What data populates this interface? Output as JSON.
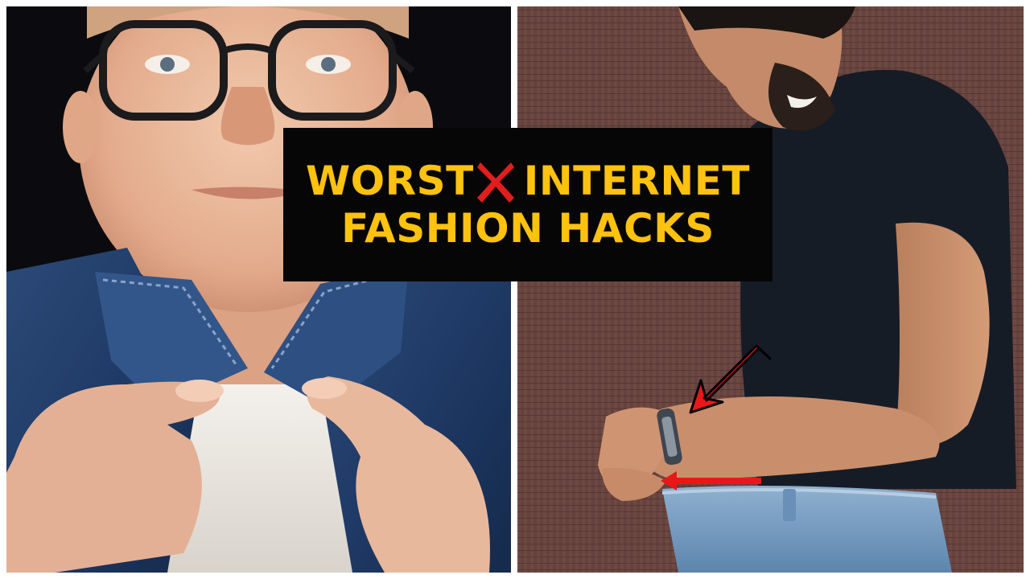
{
  "thumbnail": {
    "title_line1_part1": "WORST",
    "title_line1_part2": "INTERNET",
    "title_line2": "FASHION HACKS",
    "colors": {
      "title_text": "#ffc20e",
      "title_background": "#060606",
      "x_mark": "#e01e1e",
      "arrows": "#e81818"
    },
    "icons": {
      "x_mark": "cross-mark-icon",
      "arrow_diagonal": "arrow-down-left-icon",
      "arrow_horizontal": "arrow-left-icon"
    }
  }
}
